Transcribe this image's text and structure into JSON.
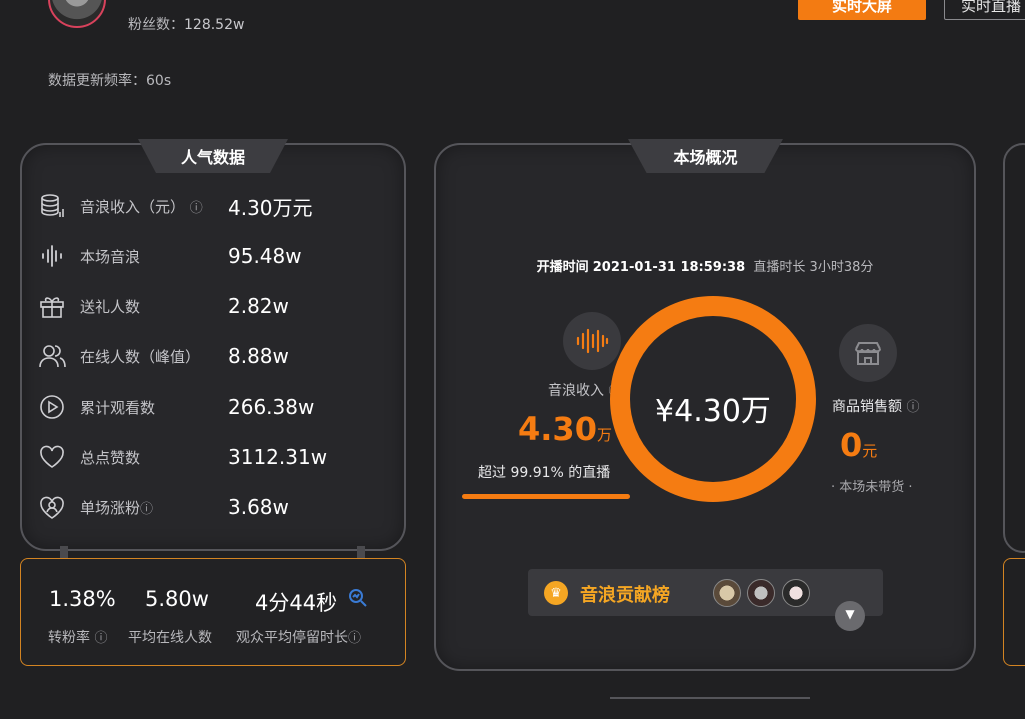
{
  "header": {
    "fans_label": "粉丝数：",
    "fans_value": "128.52w",
    "btn_screen": "实时大屏",
    "btn_live": "实时直播",
    "update_freq": "数据更新频率：60s"
  },
  "popularity": {
    "title": "人气数据",
    "rows": [
      {
        "icon": "database-icon",
        "label": "音浪收入（元）",
        "value": "4.30万元"
      },
      {
        "icon": "soundwave-icon",
        "label": "本场音浪",
        "value": "95.48w"
      },
      {
        "icon": "gift-icon",
        "label": "送礼人数",
        "value": "2.82w"
      },
      {
        "icon": "users-icon",
        "label": "在线人数（峰值）",
        "value": "8.88w"
      },
      {
        "icon": "play-icon",
        "label": "累计观看数",
        "value": "266.38w"
      },
      {
        "icon": "heart-icon",
        "label": "总点赞数",
        "value": "3112.31w"
      },
      {
        "icon": "heart-person-icon",
        "label": "单场涨粉",
        "value": "3.68w"
      }
    ],
    "summary": [
      {
        "value": "1.38%",
        "label": "转粉率"
      },
      {
        "value": "5.80w",
        "label": "平均在线人数"
      },
      {
        "value": "4分44秒",
        "label": "观众平均停留时长"
      }
    ]
  },
  "overview": {
    "title": "本场概况",
    "start_label": "开播时间",
    "start_time": "2021-01-31 18:59:38",
    "duration_label": "直播时长",
    "duration": "3小时38分",
    "center_value": "¥4.30万",
    "income_label": "音浪收入",
    "income_value": "4.30",
    "income_unit": "万",
    "exceed_text": "超过 99.91% 的直播",
    "exceed_fraction": 0.9991,
    "sales_label": "商品销售额",
    "sales_value": "0",
    "sales_unit": "元",
    "sales_note": "· 本场未带货 ·",
    "contrib_label": "音浪贡献榜"
  },
  "colors": {
    "accent": "#f57c12",
    "panel_border": "#55555a",
    "summary_border": "#d38422"
  }
}
